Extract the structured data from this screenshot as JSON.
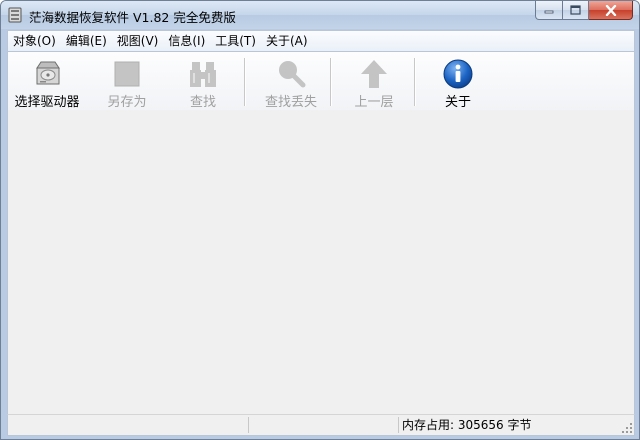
{
  "window": {
    "title": "茫海数据恢复软件 V1.82 完全免费版"
  },
  "menu": [
    {
      "label": "对象(O)"
    },
    {
      "label": "编辑(E)"
    },
    {
      "label": "视图(V)"
    },
    {
      "label": "信息(I)"
    },
    {
      "label": "工具(T)"
    },
    {
      "label": "关于(A)"
    }
  ],
  "toolbar": {
    "select_drive": {
      "label": "选择驱动器",
      "icon": "hard-drive-icon",
      "enabled": true
    },
    "save_as": {
      "label": "另存为",
      "icon": "floppy-disk-icon",
      "enabled": false
    },
    "find": {
      "label": "查找",
      "icon": "binoculars-icon",
      "enabled": false
    },
    "find_lost": {
      "label": "查找丢失",
      "icon": "magnifier-icon",
      "enabled": false
    },
    "up_level": {
      "label": "上一层",
      "icon": "up-arrow-icon",
      "enabled": false
    },
    "about": {
      "label": "关于",
      "icon": "info-icon",
      "enabled": true
    }
  },
  "statusbar": {
    "memory": "内存占用: 305656 字节"
  },
  "colors": {
    "info_blue": "#1c64c4",
    "disabled_gray": "#a0a0a0",
    "close_red": "#c8402b"
  }
}
